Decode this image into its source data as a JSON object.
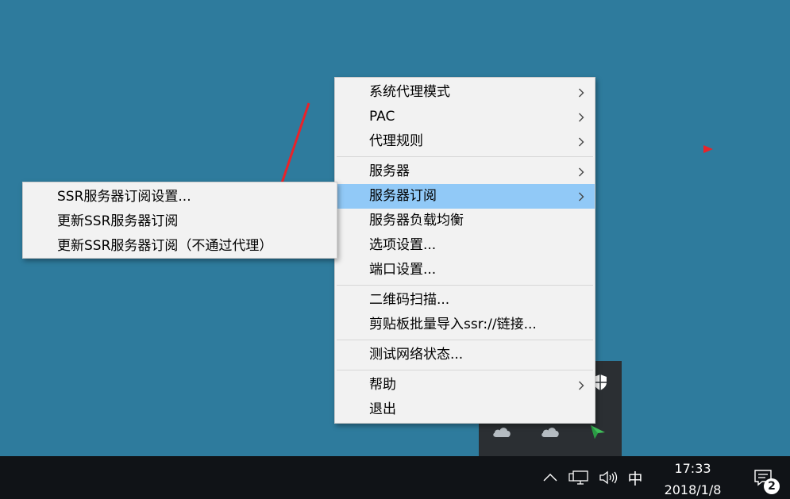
{
  "main_menu": {
    "items": [
      {
        "label": "系统代理模式",
        "has_submenu": true
      },
      {
        "label": "PAC",
        "has_submenu": true
      },
      {
        "label": "代理规则",
        "has_submenu": true
      },
      {
        "label": "服务器",
        "has_submenu": true
      },
      {
        "label": "服务器订阅",
        "has_submenu": true,
        "active": true
      },
      {
        "label": "服务器负载均衡",
        "has_submenu": false
      },
      {
        "label": "选项设置...",
        "has_submenu": false
      },
      {
        "label": "端口设置...",
        "has_submenu": false
      },
      {
        "label": "二维码扫描...",
        "has_submenu": false
      },
      {
        "label": "剪贴板批量导入ssr://链接...",
        "has_submenu": false
      },
      {
        "label": "测试网络状态...",
        "has_submenu": false
      },
      {
        "label": "帮助",
        "has_submenu": true
      },
      {
        "label": "退出",
        "has_submenu": false
      }
    ]
  },
  "sub_menu": {
    "items": [
      {
        "label": "SSR服务器订阅设置..."
      },
      {
        "label": "更新SSR服务器订阅"
      },
      {
        "label": "更新SSR服务器订阅（不通过代理）"
      }
    ]
  },
  "taskbar": {
    "ime_label": "中",
    "clock_time": "17:33",
    "clock_date": "2018/1/8",
    "notification_count": "2"
  },
  "colors": {
    "desktop": "#2e7b9d",
    "menu_bg": "#f2f2f2",
    "menu_highlight": "#91c9f7",
    "taskbar": "#101317",
    "annotation": "#e8232a"
  },
  "icons": {
    "chevron": "chevron-right-icon",
    "tray_up": "chevron-up-icon",
    "network": "network-icon",
    "volume": "volume-icon",
    "notifications": "action-center-icon",
    "tray_shield": "shield-icon",
    "tray_cloud": "onedrive-cloud-icon",
    "tray_ssr": "ssr-paper-plane-icon"
  }
}
